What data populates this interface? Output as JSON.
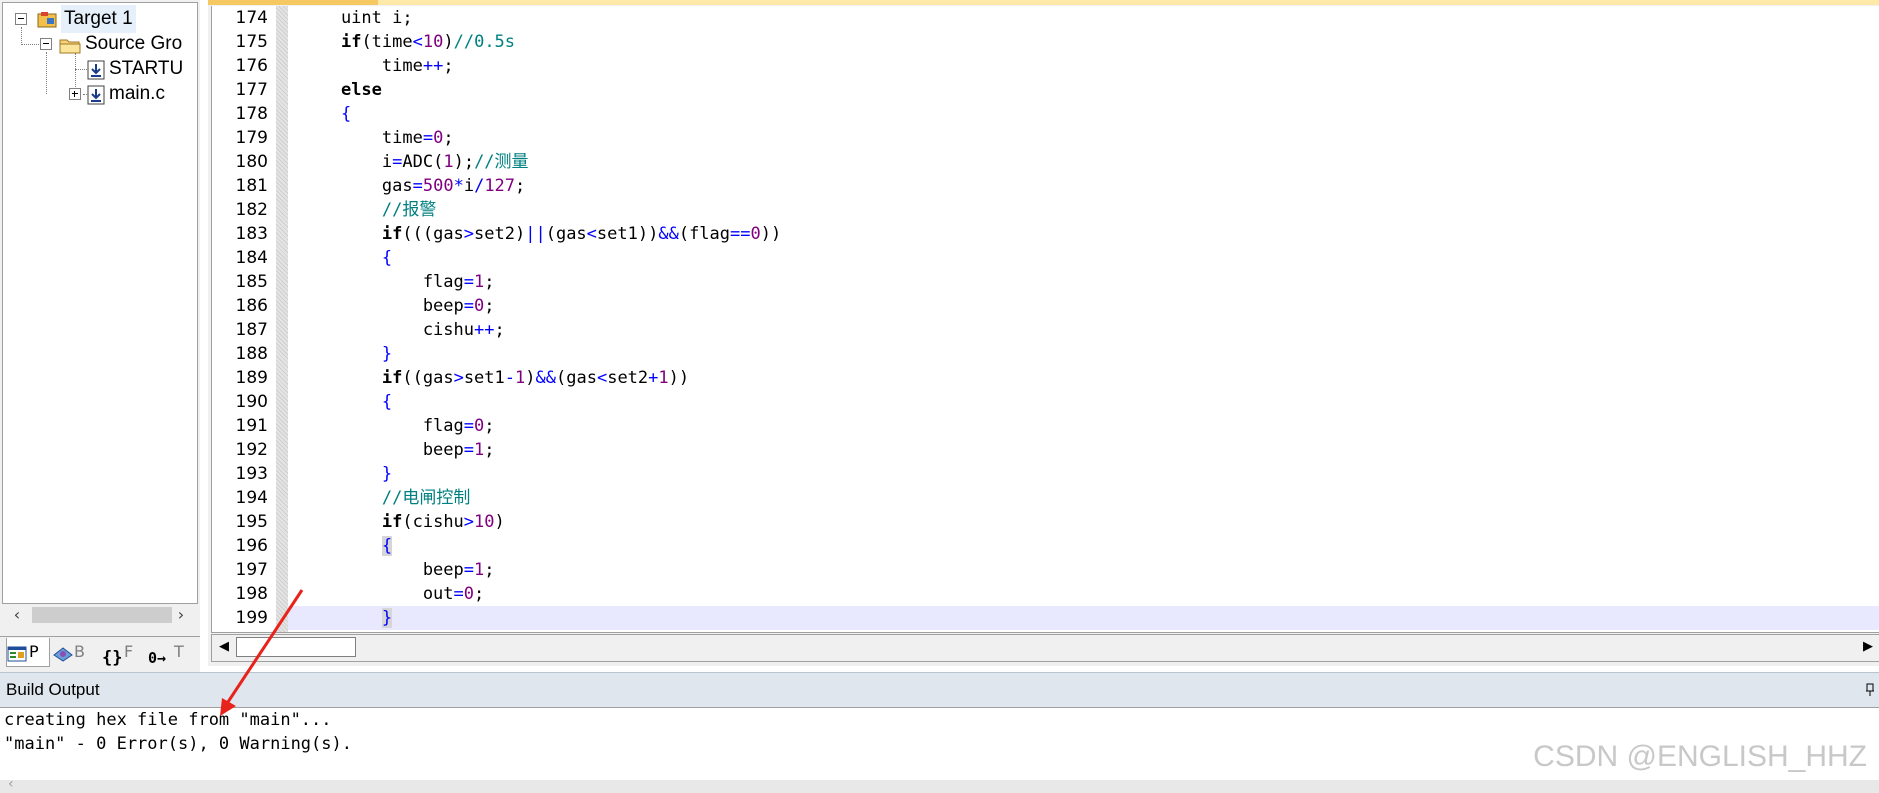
{
  "project_panel": {
    "tree": [
      {
        "label": "Target 1",
        "icon": "target-icon",
        "expander": "minus"
      },
      {
        "label": "Source Gro",
        "icon": "folder-icon",
        "expander": "minus"
      },
      {
        "label": "STARTU",
        "icon": "source-file-icon",
        "expander": ""
      },
      {
        "label": "main.c",
        "icon": "source-file-icon",
        "expander": "plus"
      }
    ],
    "tabs": [
      {
        "label": "P",
        "icon": "project-tab-icon",
        "active": true
      },
      {
        "label": "B",
        "icon": "books-tab-icon",
        "active": false
      },
      {
        "label": "F",
        "icon": "functions-tab-icon",
        "glyph": "{}",
        "active": false
      },
      {
        "label": "T",
        "icon": "templates-tab-icon",
        "glyph": "0→",
        "active": false
      }
    ]
  },
  "editor": {
    "current_line": 199,
    "lines": [
      {
        "n": "174",
        "code": [
          {
            "t": "    uint i;"
          }
        ]
      },
      {
        "n": "175",
        "code": [
          {
            "t": "    "
          },
          {
            "t": "if",
            "c": "kw"
          },
          {
            "t": "(time"
          },
          {
            "t": "<",
            "c": "op"
          },
          {
            "t": "10",
            "c": "num"
          },
          {
            "t": ")"
          },
          {
            "t": "//0.5s",
            "c": "cm"
          }
        ]
      },
      {
        "n": "176",
        "code": [
          {
            "t": "        time"
          },
          {
            "t": "++",
            "c": "op"
          },
          {
            "t": ";"
          }
        ]
      },
      {
        "n": "177",
        "code": [
          {
            "t": "    "
          },
          {
            "t": "else",
            "c": "kw"
          }
        ]
      },
      {
        "n": "178",
        "code": [
          {
            "t": "    "
          },
          {
            "t": "{",
            "c": "op"
          }
        ]
      },
      {
        "n": "179",
        "code": [
          {
            "t": "        time"
          },
          {
            "t": "=",
            "c": "op"
          },
          {
            "t": "0",
            "c": "num"
          },
          {
            "t": ";"
          }
        ]
      },
      {
        "n": "180",
        "code": [
          {
            "t": "        i"
          },
          {
            "t": "=",
            "c": "op"
          },
          {
            "t": "ADC("
          },
          {
            "t": "1",
            "c": "num"
          },
          {
            "t": ");"
          },
          {
            "t": "//测量",
            "c": "cm"
          }
        ]
      },
      {
        "n": "181",
        "code": [
          {
            "t": "        gas"
          },
          {
            "t": "=",
            "c": "op"
          },
          {
            "t": "500",
            "c": "num"
          },
          {
            "t": "*",
            "c": "op"
          },
          {
            "t": "i"
          },
          {
            "t": "/",
            "c": "op"
          },
          {
            "t": "127",
            "c": "num"
          },
          {
            "t": ";"
          }
        ]
      },
      {
        "n": "182",
        "code": [
          {
            "t": "        "
          },
          {
            "t": "//报警",
            "c": "cm"
          }
        ]
      },
      {
        "n": "183",
        "code": [
          {
            "t": "        "
          },
          {
            "t": "if",
            "c": "kw"
          },
          {
            "t": "(((gas"
          },
          {
            "t": ">",
            "c": "op"
          },
          {
            "t": "set2)"
          },
          {
            "t": "||",
            "c": "op"
          },
          {
            "t": "(gas"
          },
          {
            "t": "<",
            "c": "op"
          },
          {
            "t": "set1))"
          },
          {
            "t": "&&",
            "c": "op"
          },
          {
            "t": "(flag"
          },
          {
            "t": "==",
            "c": "op"
          },
          {
            "t": "0",
            "c": "num"
          },
          {
            "t": "))"
          }
        ]
      },
      {
        "n": "184",
        "code": [
          {
            "t": "        "
          },
          {
            "t": "{",
            "c": "op"
          }
        ]
      },
      {
        "n": "185",
        "code": [
          {
            "t": "            flag"
          },
          {
            "t": "=",
            "c": "op"
          },
          {
            "t": "1",
            "c": "num"
          },
          {
            "t": ";"
          }
        ]
      },
      {
        "n": "186",
        "code": [
          {
            "t": "            beep"
          },
          {
            "t": "=",
            "c": "op"
          },
          {
            "t": "0",
            "c": "num"
          },
          {
            "t": ";"
          }
        ]
      },
      {
        "n": "187",
        "code": [
          {
            "t": "            cishu"
          },
          {
            "t": "++",
            "c": "op"
          },
          {
            "t": ";"
          }
        ]
      },
      {
        "n": "188",
        "code": [
          {
            "t": "        "
          },
          {
            "t": "}",
            "c": "op"
          }
        ]
      },
      {
        "n": "189",
        "code": [
          {
            "t": "        "
          },
          {
            "t": "if",
            "c": "kw"
          },
          {
            "t": "((gas"
          },
          {
            "t": ">",
            "c": "op"
          },
          {
            "t": "set1"
          },
          {
            "t": "-",
            "c": "op"
          },
          {
            "t": "1",
            "c": "num"
          },
          {
            "t": ")"
          },
          {
            "t": "&&",
            "c": "op"
          },
          {
            "t": "(gas"
          },
          {
            "t": "<",
            "c": "op"
          },
          {
            "t": "set2"
          },
          {
            "t": "+",
            "c": "op"
          },
          {
            "t": "1",
            "c": "num"
          },
          {
            "t": "))"
          }
        ]
      },
      {
        "n": "190",
        "code": [
          {
            "t": "        "
          },
          {
            "t": "{",
            "c": "op"
          }
        ]
      },
      {
        "n": "191",
        "code": [
          {
            "t": "            flag"
          },
          {
            "t": "=",
            "c": "op"
          },
          {
            "t": "0",
            "c": "num"
          },
          {
            "t": ";"
          }
        ]
      },
      {
        "n": "192",
        "code": [
          {
            "t": "            beep"
          },
          {
            "t": "=",
            "c": "op"
          },
          {
            "t": "1",
            "c": "num"
          },
          {
            "t": ";"
          }
        ]
      },
      {
        "n": "193",
        "code": [
          {
            "t": "        "
          },
          {
            "t": "}",
            "c": "op"
          }
        ]
      },
      {
        "n": "194",
        "code": [
          {
            "t": "        "
          },
          {
            "t": "//电闸控制",
            "c": "cm"
          }
        ]
      },
      {
        "n": "195",
        "code": [
          {
            "t": "        "
          },
          {
            "t": "if",
            "c": "kw"
          },
          {
            "t": "(cishu"
          },
          {
            "t": ">",
            "c": "op"
          },
          {
            "t": "10",
            "c": "num"
          },
          {
            "t": ")"
          }
        ]
      },
      {
        "n": "196",
        "code": [
          {
            "t": "        "
          },
          {
            "t": "{",
            "c": "op brace-hl"
          }
        ]
      },
      {
        "n": "197",
        "code": [
          {
            "t": "            beep"
          },
          {
            "t": "=",
            "c": "op"
          },
          {
            "t": "1",
            "c": "num"
          },
          {
            "t": ";"
          }
        ]
      },
      {
        "n": "198",
        "code": [
          {
            "t": "            out"
          },
          {
            "t": "=",
            "c": "op"
          },
          {
            "t": "0",
            "c": "num"
          },
          {
            "t": ";"
          }
        ]
      },
      {
        "n": "199",
        "code": [
          {
            "t": "        "
          },
          {
            "t": "}",
            "c": "op brace-hl"
          }
        ]
      }
    ]
  },
  "build_output": {
    "title": "Build Output",
    "lines": [
      "creating hex file from \"main\"...",
      "\"main\" - 0 Error(s), 0 Warning(s)."
    ]
  },
  "watermark": "CSDN @ENGLISH_HHZ",
  "colors": {
    "keyword": "#000000",
    "number": "#800080",
    "operator": "#0000ff",
    "comment": "#008080",
    "current_line": "#e8e8ff",
    "annotation_arrow": "#e8231c"
  }
}
